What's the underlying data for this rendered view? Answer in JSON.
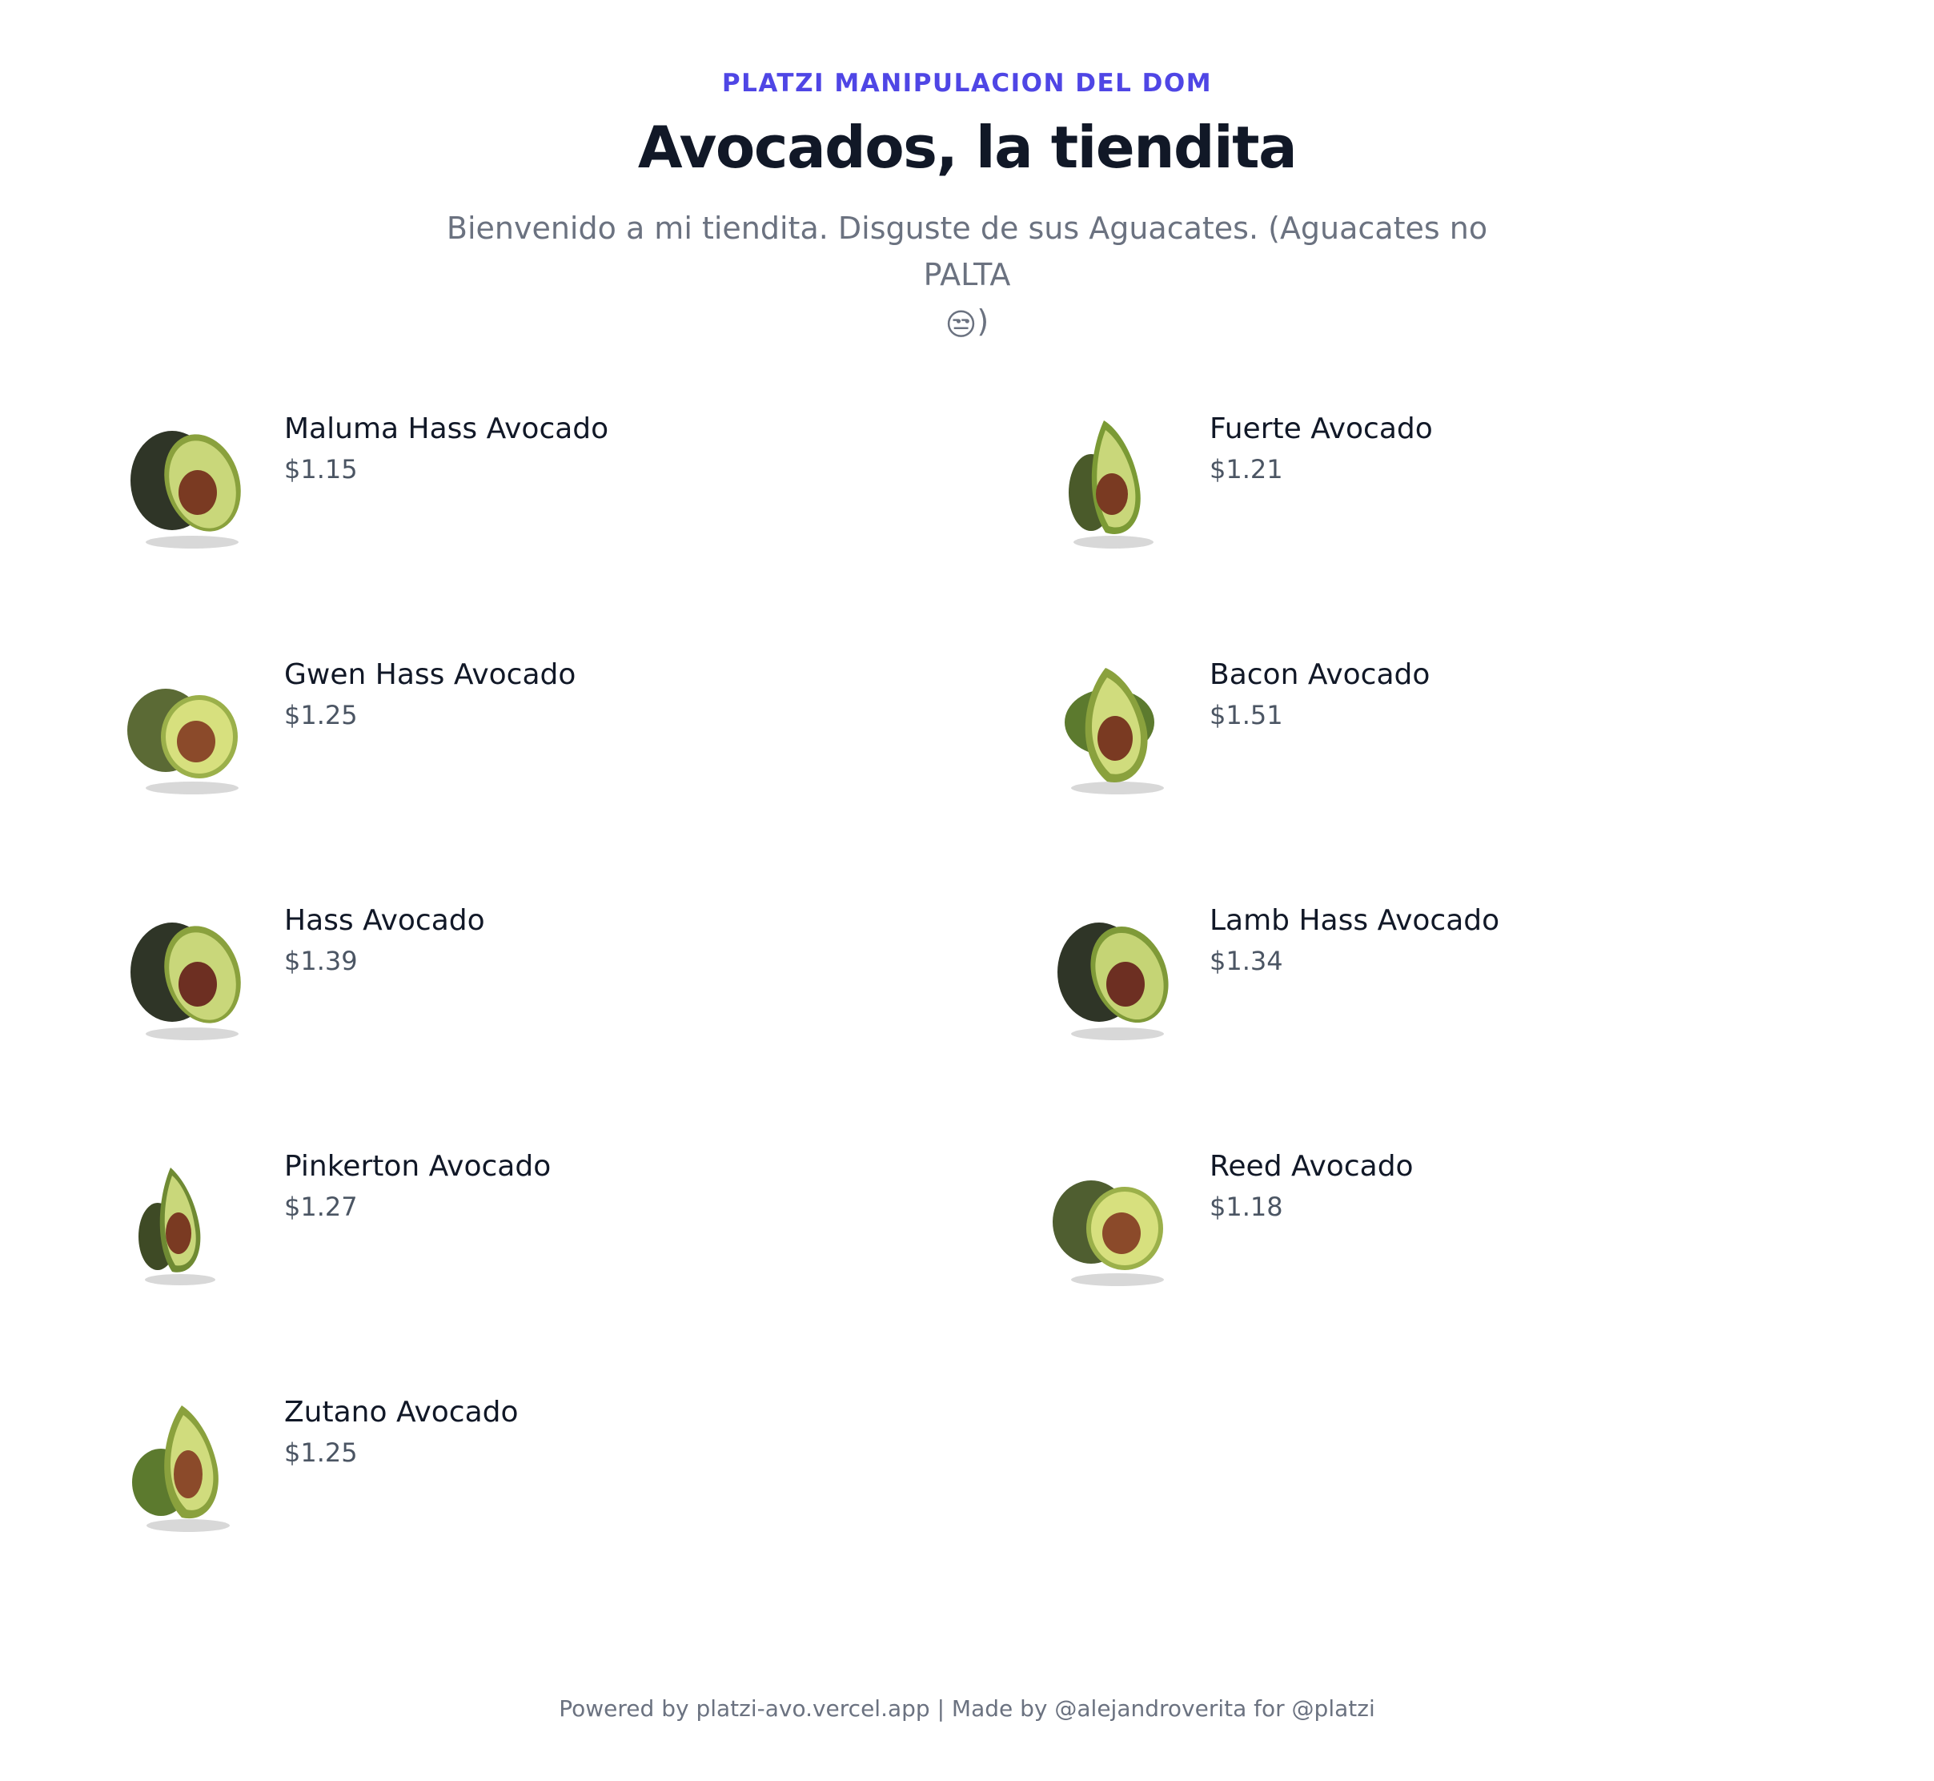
{
  "header": {
    "eyebrow": "PLATZI MANIPULACION DEL DOM",
    "title": "Avocados, la tiendita",
    "subtitle": "Bienvenido a mi tiendita. Disguste de sus Aguacates. (Aguacates no PALTA",
    "subtitle_emoji": "😒",
    "subtitle_close": ")"
  },
  "products": [
    {
      "name": "Maluma Hass Avocado",
      "price": "$1.15",
      "image": "avocado-photo-hass-half"
    },
    {
      "name": "Fuerte Avocado",
      "price": "$1.21",
      "image": "avocado-photo-fuerte-half"
    },
    {
      "name": "Gwen Hass Avocado",
      "price": "$1.25",
      "image": "avocado-photo-gwen-half"
    },
    {
      "name": "Bacon Avocado",
      "price": "$1.51",
      "image": "avocado-photo-bacon-half"
    },
    {
      "name": "Hass Avocado",
      "price": "$1.39",
      "image": "avocado-photo-hass-half"
    },
    {
      "name": "Lamb Hass Avocado",
      "price": "$1.34",
      "image": "avocado-photo-lamb-half"
    },
    {
      "name": "Pinkerton Avocado",
      "price": "$1.27",
      "image": "avocado-photo-pinkerton-half"
    },
    {
      "name": "Reed Avocado",
      "price": "$1.18",
      "image": "avocado-photo-reed-half"
    },
    {
      "name": "Zutano Avocado",
      "price": "$1.25",
      "image": "avocado-photo-zutano-half"
    }
  ],
  "footer": {
    "text": "Powered by platzi-avo.vercel.app | Made by @alejandroverita for @platzi"
  },
  "colors": {
    "accent": "#4f46e5",
    "title": "#111827",
    "muted": "#6b7280",
    "price": "#4b5563",
    "skin_dark": "#2f3527",
    "skin_green": "#5c7a2e",
    "flesh": "#c9d77a",
    "flesh_edge": "#9bb04a",
    "pit": "#7a3a22"
  }
}
